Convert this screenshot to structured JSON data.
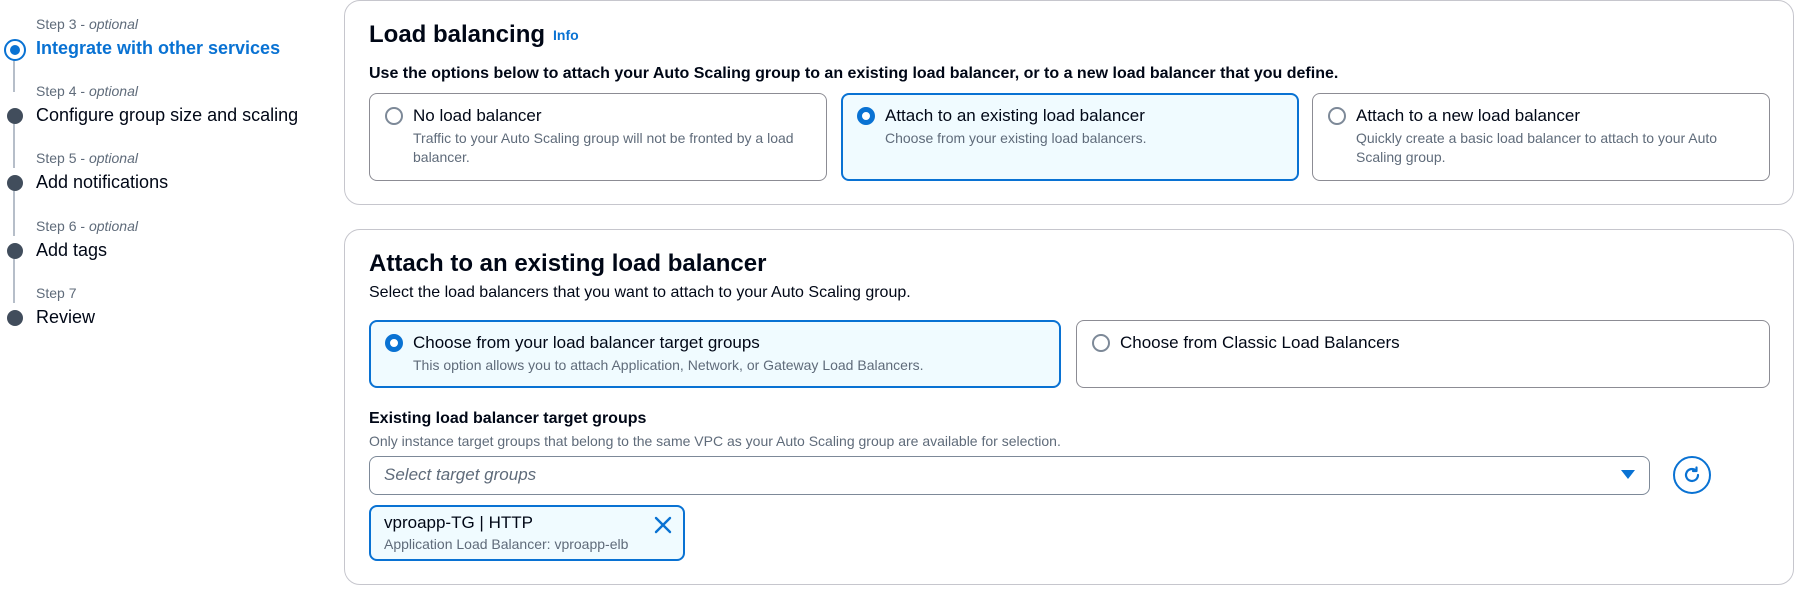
{
  "steps": [
    {
      "num": "Step 3",
      "optional": "optional",
      "title": "Integrate with other services",
      "active": true
    },
    {
      "num": "Step 4",
      "optional": "optional",
      "title": "Configure group size and scaling",
      "active": false
    },
    {
      "num": "Step 5",
      "optional": "optional",
      "title": "Add notifications",
      "active": false
    },
    {
      "num": "Step 6",
      "optional": "optional",
      "title": "Add tags",
      "active": false
    },
    {
      "num": "Step 7",
      "optional": "",
      "title": "Review",
      "active": false
    }
  ],
  "load_balancing": {
    "title": "Load balancing",
    "info": "Info",
    "description": "Use the options below to attach your Auto Scaling group to an existing load balancer, or to a new load balancer that you define.",
    "options": [
      {
        "label": "No load balancer",
        "sub": "Traffic to your Auto Scaling group will not be fronted by a load balancer.",
        "selected": false
      },
      {
        "label": "Attach to an existing load balancer",
        "sub": "Choose from your existing load balancers.",
        "selected": true
      },
      {
        "label": "Attach to a new load balancer",
        "sub": "Quickly create a basic load balancer to attach to your Auto Scaling group.",
        "selected": false
      }
    ]
  },
  "attach_existing": {
    "title": "Attach to an existing load balancer",
    "description": "Select the load balancers that you want to attach to your Auto Scaling group.",
    "options": [
      {
        "label": "Choose from your load balancer target groups",
        "sub": "This option allows you to attach Application, Network, or Gateway Load Balancers.",
        "selected": true
      },
      {
        "label": "Choose from Classic Load Balancers",
        "sub": "",
        "selected": false
      }
    ],
    "target_groups": {
      "label": "Existing load balancer target groups",
      "description": "Only instance target groups that belong to the same VPC as your Auto Scaling group are available for selection.",
      "placeholder": "Select target groups",
      "token": {
        "label": "vproapp-TG | HTTP",
        "sub": "Application Load Balancer: vproapp-elb"
      }
    }
  },
  "colors": {
    "accent": "#0972d3",
    "selected_bg": "#f0fbff",
    "border": "#c6c6cd",
    "text_secondary": "#5f6b7a"
  },
  "icons": {
    "refresh": "refresh-icon",
    "dismiss": "close-icon",
    "dropdown": "caret-down-icon"
  }
}
